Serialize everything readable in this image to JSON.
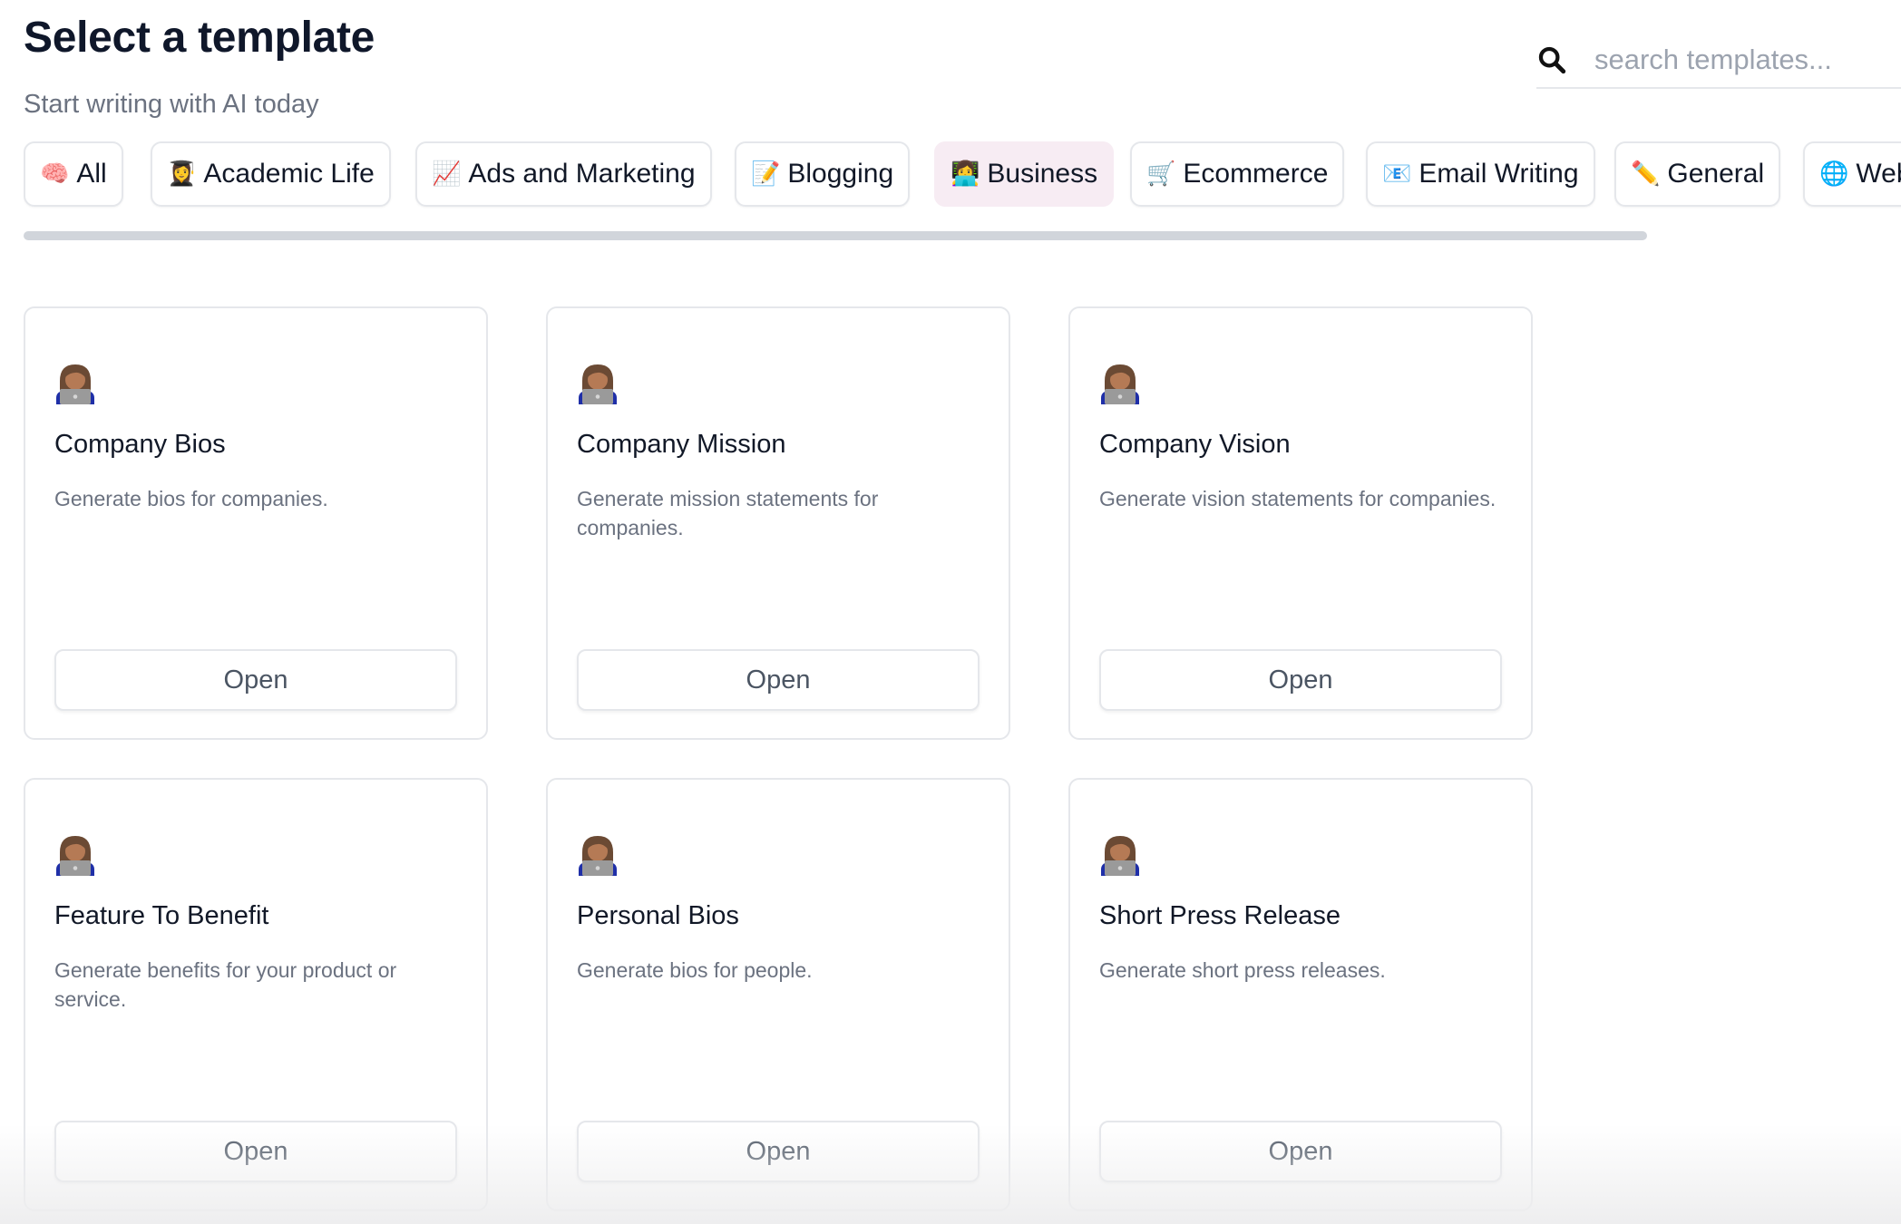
{
  "header": {
    "title": "Select a template",
    "subtitle": "Start writing with AI today"
  },
  "search": {
    "placeholder": "search templates...",
    "value": "",
    "icon": "search-icon"
  },
  "categories": [
    {
      "emoji": "🧠",
      "label": "All",
      "icon": "brain-icon",
      "active": false
    },
    {
      "emoji": "👩‍🎓",
      "label": "Academic Life",
      "icon": "student-icon",
      "active": false
    },
    {
      "emoji": "📈",
      "label": "Ads and Marketing",
      "icon": "chart-up-icon",
      "active": false
    },
    {
      "emoji": "📝",
      "label": "Blogging",
      "icon": "memo-icon",
      "active": false
    },
    {
      "emoji": "👩‍💻",
      "label": "Business",
      "icon": "technologist-icon",
      "active": true
    },
    {
      "emoji": "🛒",
      "label": "Ecommerce",
      "icon": "cart-icon",
      "active": false
    },
    {
      "emoji": "📧",
      "label": "Email Writing",
      "icon": "email-icon",
      "active": false
    },
    {
      "emoji": "✏️",
      "label": "General",
      "icon": "pencil-icon",
      "active": false
    },
    {
      "emoji": "🌐",
      "label": "Web",
      "icon": "globe-icon",
      "active": false
    }
  ],
  "templates": [
    {
      "title": "Company Bios",
      "description": "Generate bios for companies.",
      "button": "Open",
      "icon": "technologist-icon"
    },
    {
      "title": "Company Mission",
      "description": "Generate mission statements for companies.",
      "button": "Open",
      "icon": "technologist-icon"
    },
    {
      "title": "Company Vision",
      "description": "Generate vision statements for companies.",
      "button": "Open",
      "icon": "technologist-icon"
    },
    {
      "title": "Feature To Benefit",
      "description": "Generate benefits for your product or service.",
      "button": "Open",
      "icon": "technologist-icon"
    },
    {
      "title": "Personal Bios",
      "description": "Generate bios for people.",
      "button": "Open",
      "icon": "technologist-icon"
    },
    {
      "title": "Short Press Release",
      "description": "Generate short press releases.",
      "button": "Open",
      "icon": "technologist-icon"
    }
  ],
  "colors": {
    "active_chip_bg": "#f7ecf3",
    "border": "#e5e7eb",
    "muted_text": "#6b7280"
  }
}
